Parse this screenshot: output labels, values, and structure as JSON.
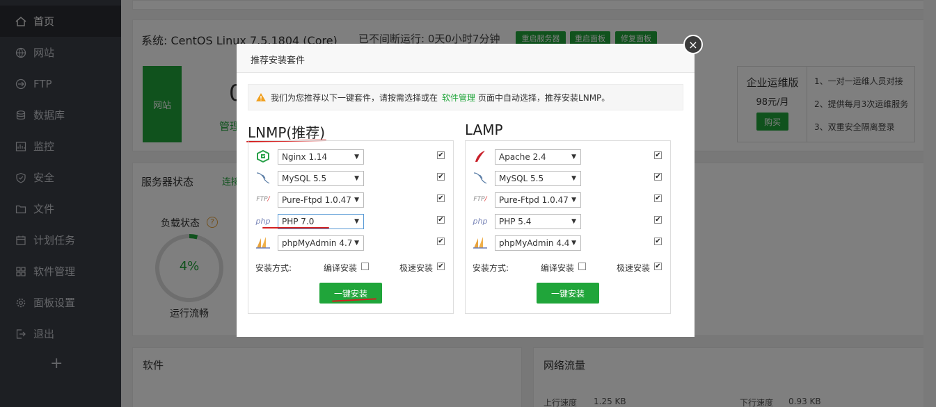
{
  "sidebar": {
    "items": [
      {
        "label": "首页",
        "icon": "home-icon"
      },
      {
        "label": "网站",
        "icon": "globe-icon"
      },
      {
        "label": "FTP",
        "icon": "ftp-icon"
      },
      {
        "label": "数据库",
        "icon": "database-icon"
      },
      {
        "label": "监控",
        "icon": "monitor-icon"
      },
      {
        "label": "安全",
        "icon": "shield-icon"
      },
      {
        "label": "文件",
        "icon": "folder-icon"
      },
      {
        "label": "计划任务",
        "icon": "calendar-icon"
      },
      {
        "label": "软件管理",
        "icon": "grid-icon"
      },
      {
        "label": "面板设置",
        "icon": "gear-icon"
      },
      {
        "label": "退出",
        "icon": "logout-icon"
      }
    ],
    "add_label": "+"
  },
  "system": {
    "label": "系统: CentOS Linux 7.5.1804 (Core)",
    "uptime": "已不间断运行: 0天0小时7分钟",
    "buttons": [
      "重启服务器",
      "重启面板",
      "修复面板"
    ]
  },
  "overview": {
    "site_tile": "网站",
    "count": "0",
    "manage": "管理"
  },
  "enterprise": {
    "title": "企业运维版",
    "price": "98元/月",
    "buy": "购买",
    "features": [
      "1、一对一运维人员对接",
      "2、提供每月3次运维服务",
      "3、双重安全隔离登录"
    ]
  },
  "server_status": {
    "title": "服务器状态",
    "tab": "连接",
    "load_label": "负载状态",
    "load_value": 4,
    "load_text": "4%",
    "load_caption": "运行流畅"
  },
  "bottom": {
    "software": "软件",
    "network": "网络流量",
    "up_label": "上行速度",
    "up_value": "1.25 KB",
    "down_label": "下行速度",
    "down_value": "0.93 KB"
  },
  "modal": {
    "title": "推荐安装套件",
    "close": "×",
    "notice_pre": "我们为您推荐以下一键套件，请按需选择或在",
    "notice_link": "软件管理",
    "notice_post": "页面中自动选择，推荐安装LNMP。",
    "install_method": "安装方式:",
    "compile": "编译安装",
    "fast": "极速安装",
    "install_btn": "一键安装",
    "lnmp": {
      "title": "LNMP(推荐)",
      "rows": [
        {
          "icon": "nginx-icon",
          "value": "Nginx 1.14",
          "checked": true
        },
        {
          "icon": "mysql-icon",
          "value": "MySQL 5.5",
          "checked": true
        },
        {
          "icon": "ftp-logo-icon",
          "value": "Pure-Ftpd 1.0.47",
          "checked": true
        },
        {
          "icon": "php-icon",
          "value": "PHP 7.0",
          "checked": true
        },
        {
          "icon": "phpmyadmin-icon",
          "value": "phpMyAdmin 4.7",
          "checked": true
        }
      ],
      "compile_checked": false,
      "fast_checked": true
    },
    "lamp": {
      "title": "LAMP",
      "rows": [
        {
          "icon": "apache-icon",
          "value": "Apache 2.4",
          "checked": true
        },
        {
          "icon": "mysql-icon",
          "value": "MySQL 5.5",
          "checked": true
        },
        {
          "icon": "ftp-logo-icon",
          "value": "Pure-Ftpd 1.0.47",
          "checked": true
        },
        {
          "icon": "php-icon",
          "value": "PHP 5.4",
          "checked": true
        },
        {
          "icon": "phpmyadmin-icon",
          "value": "phpMyAdmin 4.4",
          "checked": true
        }
      ],
      "compile_checked": false,
      "fast_checked": true
    }
  }
}
